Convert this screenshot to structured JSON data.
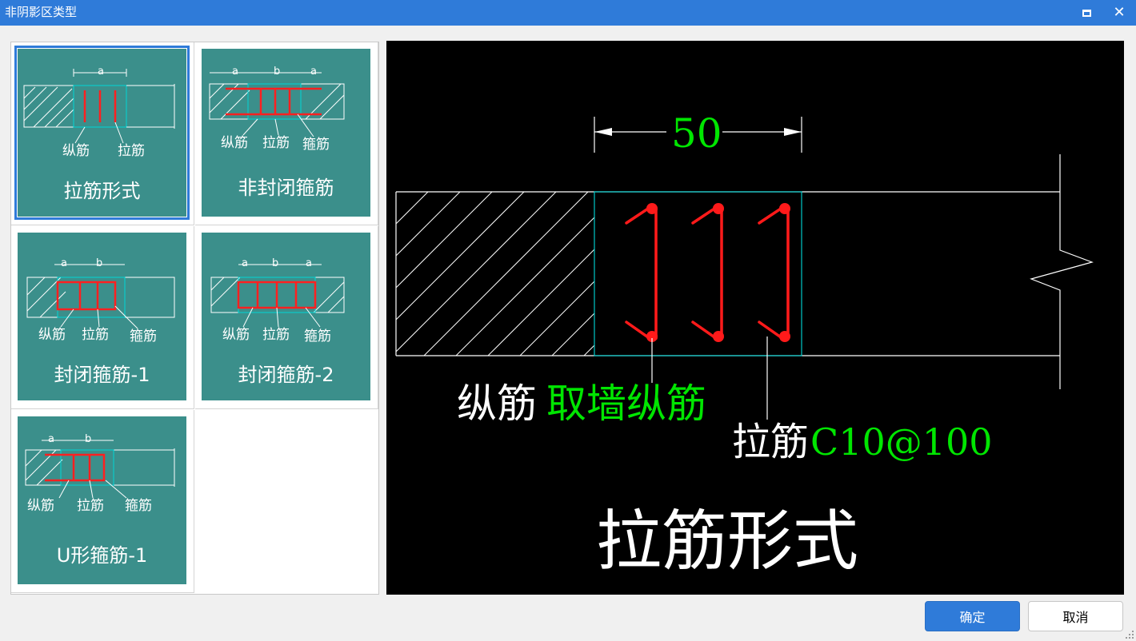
{
  "window": {
    "title": "非阴影区类型",
    "maximize_icon": "maximize-icon",
    "close_icon": "close-icon",
    "close_glyph": "✕"
  },
  "thumbnails": [
    {
      "caption": "拉筋形式",
      "labels": [
        "纵筋",
        "拉筋"
      ],
      "dims": [
        "a"
      ],
      "selected": true
    },
    {
      "caption": "非封闭箍筋",
      "labels": [
        "纵筋",
        "拉筋",
        "箍筋"
      ],
      "dims": [
        "a",
        "b",
        "a"
      ],
      "selected": false
    },
    {
      "caption": "封闭箍筋-1",
      "labels": [
        "纵筋",
        "拉筋",
        "箍筋"
      ],
      "dims": [
        "a",
        "b"
      ],
      "selected": false
    },
    {
      "caption": "封闭箍筋-2",
      "labels": [
        "纵筋",
        "拉筋",
        "箍筋"
      ],
      "dims": [
        "a",
        "b",
        "a"
      ],
      "selected": false
    },
    {
      "caption": "U形箍筋-1",
      "labels": [
        "纵筋",
        "拉筋",
        "箍筋"
      ],
      "dims": [
        "a",
        "b"
      ],
      "selected": false
    }
  ],
  "preview": {
    "dimension": "50",
    "longitudinal_label": "纵筋",
    "longitudinal_value": "取墙纵筋",
    "tie_label": "拉筋",
    "tie_value": "C10@100",
    "caption": "拉筋形式",
    "colors": {
      "white": "#ffffff",
      "green": "#00e600",
      "red": "#ff1a1a",
      "cyan": "#00c8c8"
    }
  },
  "buttons": {
    "ok": "确定",
    "cancel": "取消"
  }
}
